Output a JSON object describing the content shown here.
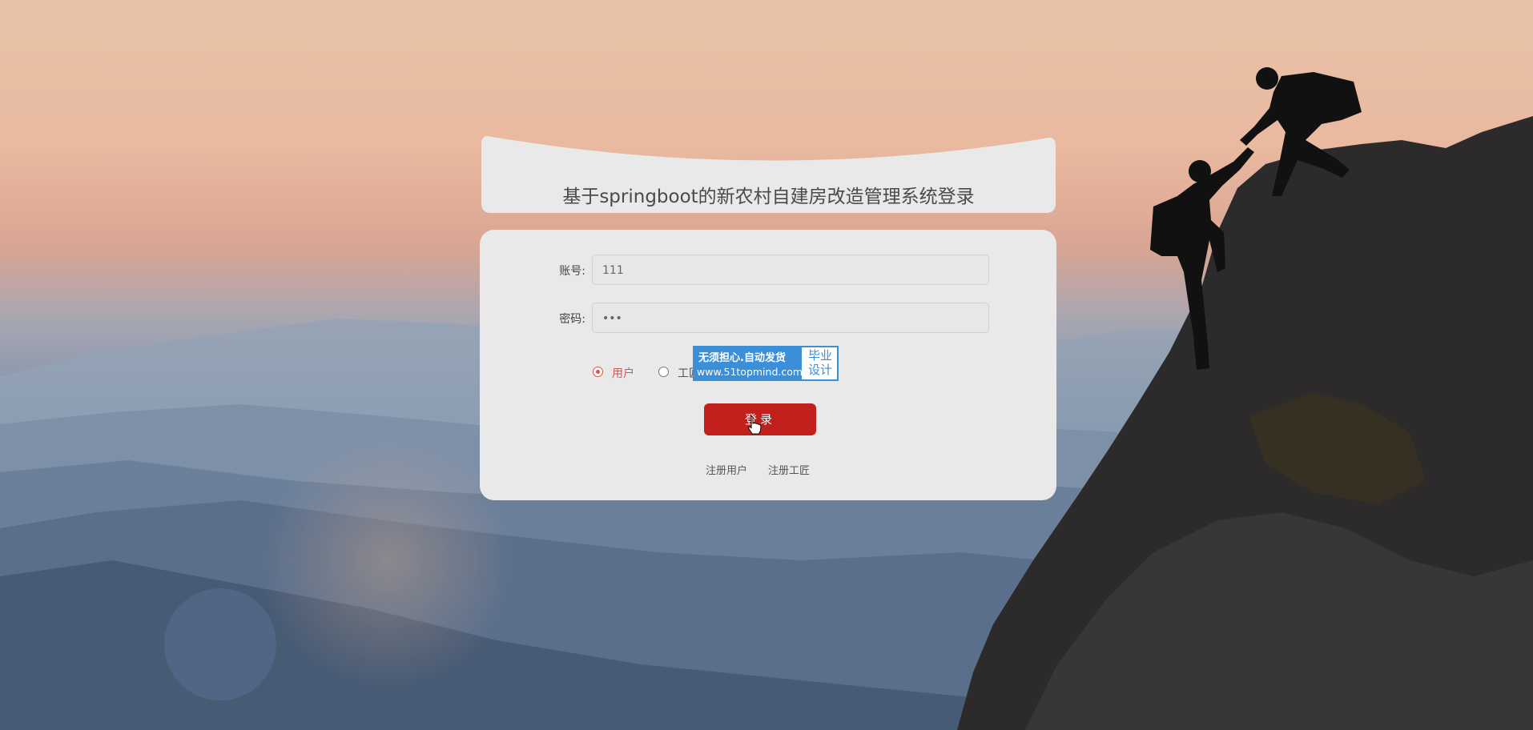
{
  "page": {
    "title": "基于springboot的新农村自建房改造管理系统登录"
  },
  "form": {
    "account_label": "账号:",
    "account_value": "111",
    "password_label": "密码:",
    "password_value": "•••",
    "roles": [
      {
        "label": "用户",
        "checked": true
      },
      {
        "label": "工匠",
        "checked": false
      }
    ],
    "login_label": "登录"
  },
  "watermark": {
    "line1": "无须担心.自动发货",
    "line2": "www.51topmind.com",
    "badge": [
      "毕业",
      "设计"
    ]
  },
  "links": {
    "register_user": "注册用户",
    "register_craftsman": "注册工匠"
  },
  "colors": {
    "accent": "#c1201c",
    "radio_checked": "#d9534f",
    "watermark_blue": "#3b8fd8",
    "card_bg": "#e9e9e9"
  }
}
